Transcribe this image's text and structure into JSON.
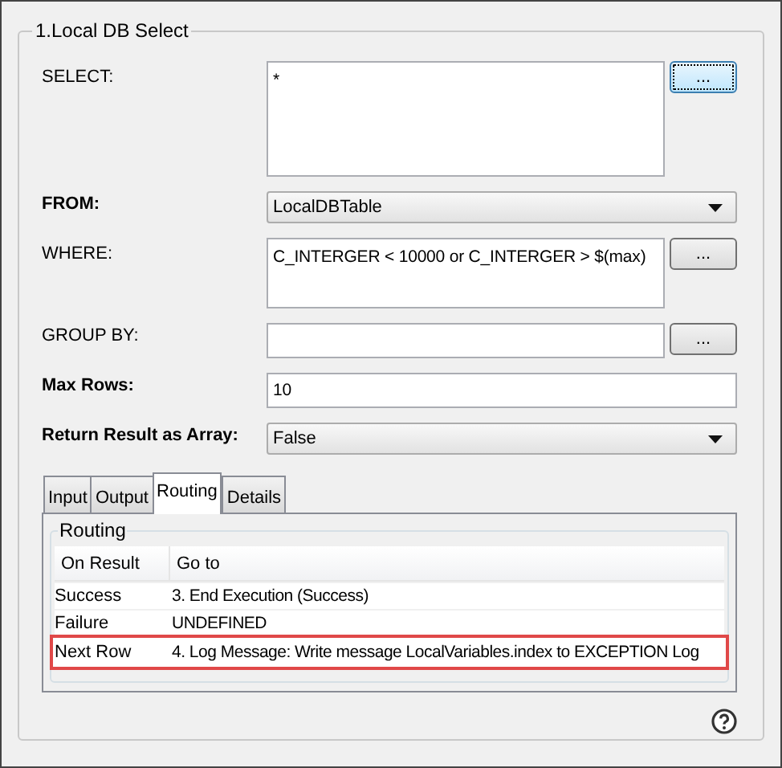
{
  "group_title": "1.Local DB Select",
  "fields": [
    {
      "kind": "textarea",
      "label": "SELECT:",
      "bold": false,
      "value": "*",
      "button": "...",
      "focused": true
    },
    {
      "kind": "dropdown",
      "label": "FROM:",
      "bold": true,
      "value": "LocalDBTable"
    },
    {
      "kind": "textarea",
      "label": "WHERE:",
      "bold": false,
      "value": "C_INTERGER < 10000 or C_INTERGER > $(max)",
      "button": "...",
      "focused": false
    },
    {
      "kind": "text",
      "label": "GROUP BY:",
      "bold": false,
      "button": "...",
      "focused": false
    },
    {
      "kind": "text",
      "label": "Max Rows:",
      "bold": true,
      "value": "10"
    },
    {
      "kind": "dropdown",
      "label": "Return Result as Array:",
      "bold": true,
      "value": "False"
    }
  ],
  "tabs": [
    {
      "label": "Input",
      "selected": false
    },
    {
      "label": "Output",
      "selected": false
    },
    {
      "label": "Routing",
      "selected": true
    },
    {
      "label": "Details",
      "selected": false
    }
  ],
  "routing": {
    "title": "Routing",
    "columns": [
      "On Result",
      "Go to"
    ],
    "rows": [
      {
        "result": "Success",
        "goto": "3. End Execution (Success)",
        "highlighted": false
      },
      {
        "result": "Failure",
        "goto": "UNDEFINED",
        "highlighted": false
      },
      {
        "result": "Next Row",
        "goto": "4. Log Message: Write message LocalVariables.index to EXCEPTION Log",
        "highlighted": true
      }
    ]
  }
}
